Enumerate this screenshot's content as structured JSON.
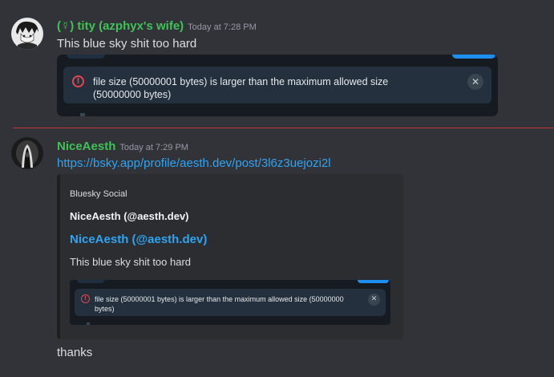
{
  "messages": [
    {
      "username": "(☿) tity (azphyx's wife)",
      "timestamp": "Today at 7:28 PM",
      "text": "This blue sky shit too hard",
      "attachment": {
        "error_text": "file size (50000001 bytes) is larger than the maximum allowed size (50000000 bytes)",
        "error_icon": "error-circle-icon",
        "close_icon": "close-icon"
      }
    },
    {
      "username": "NiceAesth",
      "timestamp": "Today at 7:29 PM",
      "link": "https://bsky.app/profile/aesth.dev/post/3l6z3uejozi2l",
      "embed": {
        "provider": "Bluesky Social",
        "author": "NiceAesth (@aesth.dev)",
        "title": "NiceAesth (@aesth.dev)",
        "description": "This blue sky shit too hard",
        "image": {
          "error_text": "file size (50000001 bytes) is larger than the maximum allowed size (50000000 bytes)"
        }
      }
    },
    {
      "text": "thanks"
    }
  ],
  "colors": {
    "background": "#323339",
    "username": "#3fc255",
    "link": "#2ea4f2",
    "new_divider": "#c2373c",
    "error": "#e0474f"
  }
}
